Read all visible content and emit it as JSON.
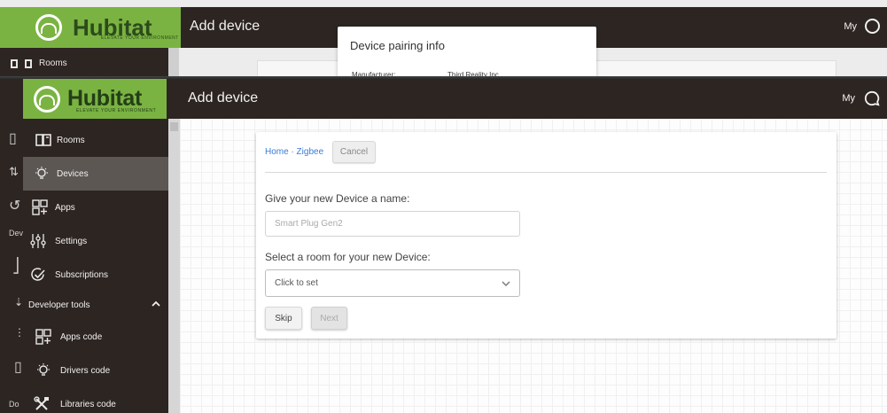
{
  "background_window": {
    "logo": {
      "word": "Hubitat",
      "tagline": "ELEVATE YOUR ENVIRONMENT"
    },
    "title": "Add device",
    "user_label": "My",
    "nav_first_item": "Rooms",
    "popup": {
      "title": "Device pairing info",
      "manufacturer_label": "Manufacturer:",
      "manufacturer_value": "Third Reality Inc"
    }
  },
  "header": {
    "logo": {
      "word": "Hubitat",
      "tagline": "ELEVATE YOUR ENVIRONMENT"
    },
    "title": "Add device",
    "user_label": "My",
    "icons": {
      "chat": "chat-bubble-icon"
    }
  },
  "sidebar": {
    "items": [
      {
        "label": "Rooms",
        "icon": "rooms-icon"
      },
      {
        "label": "Devices",
        "icon": "bulb-icon",
        "active": true
      },
      {
        "label": "Apps",
        "icon": "apps-icon"
      },
      {
        "label": "Settings",
        "icon": "settings-icon"
      },
      {
        "label": "Subscriptions",
        "icon": "check-circle-icon"
      }
    ],
    "section": {
      "label": "Developer tools",
      "expanded": true
    },
    "dev_items": [
      {
        "label": "Apps code",
        "icon": "apps-code-icon"
      },
      {
        "label": "Drivers code",
        "icon": "bulb-icon"
      },
      {
        "label": "Libraries code",
        "icon": "tools-icon"
      }
    ],
    "left_fragments": {
      "dev": "Dev",
      "do": "Do"
    }
  },
  "form": {
    "breadcrumb": "Home · Zigbee",
    "cancel_label": "Cancel",
    "name_label": "Give your new Device a name:",
    "name_placeholder": "Smart Plug Gen2",
    "room_label": "Select a room for your new Device:",
    "room_value": "Click to set",
    "skip_label": "Skip",
    "next_label": "Next"
  },
  "colors": {
    "brand_green": "#7ab342",
    "header_dark": "#2d2522",
    "link_blue": "#3a7bd5",
    "active_item": "#5d5754"
  }
}
